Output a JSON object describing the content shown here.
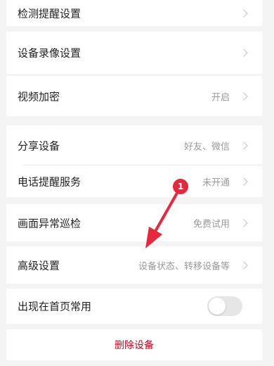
{
  "settings": {
    "detection_reminder": {
      "label": "检测提醒设置"
    },
    "recording": {
      "label": "设备录像设置"
    },
    "video_encryption": {
      "label": "视频加密",
      "value": "开启"
    },
    "share_device": {
      "label": "分享设备",
      "value": "好友、微信"
    },
    "phone_reminder": {
      "label": "电话提醒服务",
      "value": "未开通"
    },
    "anomaly_patrol": {
      "label": "画面异常巡检",
      "value": "免费试用"
    },
    "advanced": {
      "label": "高级设置",
      "value": "设备状态、转移设备等"
    },
    "show_on_home": {
      "label": "出现在首页常用",
      "enabled": false
    },
    "delete_device": {
      "label": "删除设备"
    }
  },
  "annotation": {
    "step_number": "1",
    "color": "#e8283a"
  },
  "colors": {
    "background": "#f4f4f4",
    "row_background": "#ffffff",
    "danger": "#d0021b",
    "secondary_text": "#999999"
  }
}
